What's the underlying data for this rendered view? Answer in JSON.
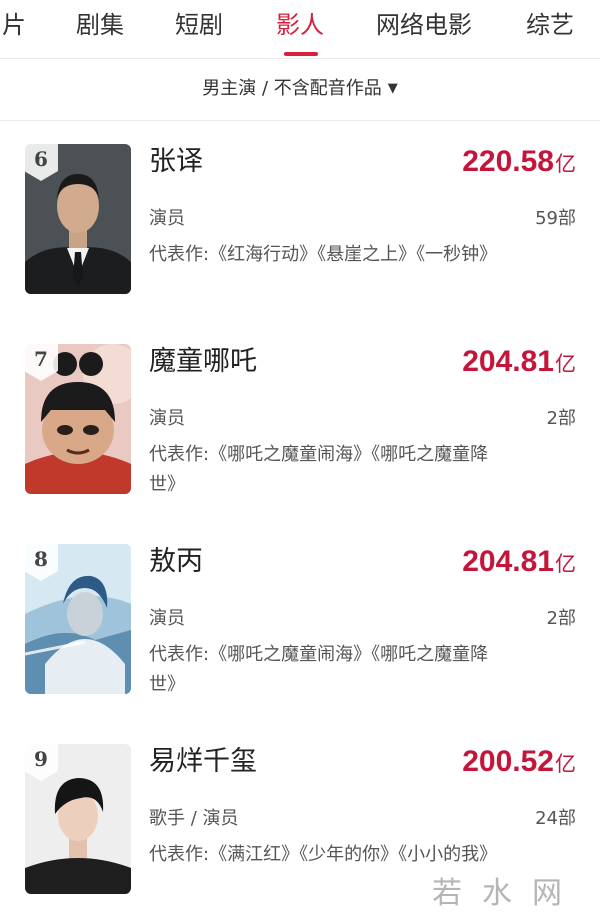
{
  "tabs": [
    {
      "label": "片",
      "active": false
    },
    {
      "label": "剧集",
      "active": false
    },
    {
      "label": "短剧",
      "active": false
    },
    {
      "label": "影人",
      "active": true
    },
    {
      "label": "网络电影",
      "active": false
    },
    {
      "label": "综艺",
      "active": false
    }
  ],
  "filter": {
    "label": "男主演 / 不含配音作品",
    "caret": "▼"
  },
  "colors": {
    "accent": "#d91f3d",
    "gross": "#c3163a"
  },
  "rows": [
    {
      "rank": "6",
      "name": "张译",
      "gross": "220.58",
      "unit": "亿",
      "role": "演员",
      "works": "59部",
      "reps": "代表作:《红海行动》《悬崖之上》《一秒钟》"
    },
    {
      "rank": "7",
      "name": "魔童哪吒",
      "gross": "204.81",
      "unit": "亿",
      "role": "演员",
      "works": "2部",
      "reps": "代表作:《哪吒之魔童闹海》《哪吒之魔童降世》"
    },
    {
      "rank": "8",
      "name": "敖丙",
      "gross": "204.81",
      "unit": "亿",
      "role": "演员",
      "works": "2部",
      "reps": "代表作:《哪吒之魔童闹海》《哪吒之魔童降世》"
    },
    {
      "rank": "9",
      "name": "易烊千玺",
      "gross": "200.52",
      "unit": "亿",
      "role": "歌手 / 演员",
      "works": "24部",
      "reps": "代表作:《满江红》《少年的你》《小小的我》"
    }
  ],
  "watermark": "若水网"
}
